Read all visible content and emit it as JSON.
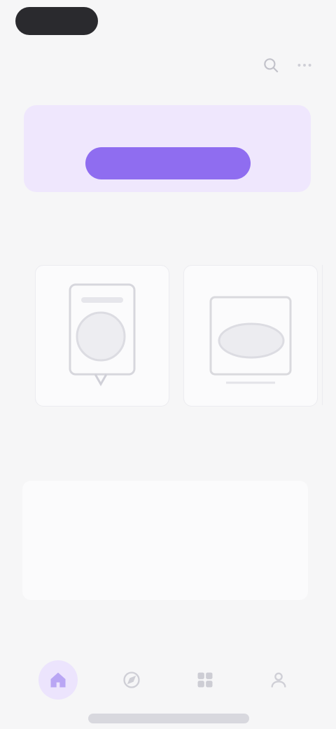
{
  "header": {
    "search_label": "",
    "more_label": ""
  },
  "banner": {
    "text": "",
    "button_label": ""
  },
  "sections": {
    "suggested_title": "",
    "news_title": ""
  },
  "cards": [
    {
      "name": "guide-illustration",
      "icon": "document-icon"
    },
    {
      "name": "hardware-illustration",
      "icon": "devices-icon"
    }
  ],
  "news": {
    "title": "",
    "body": ""
  },
  "caption": "",
  "nav": [
    {
      "name": "home",
      "icon": "home-icon",
      "active": true
    },
    {
      "name": "explore",
      "icon": "explore-icon",
      "active": false
    },
    {
      "name": "apps",
      "icon": "grid-icon",
      "active": false
    },
    {
      "name": "account",
      "icon": "person-icon",
      "active": false
    }
  ],
  "colors": {
    "accent": "#8f6df0",
    "banner_bg": "#efe7fd",
    "page_bg": "#f6f6f7"
  }
}
